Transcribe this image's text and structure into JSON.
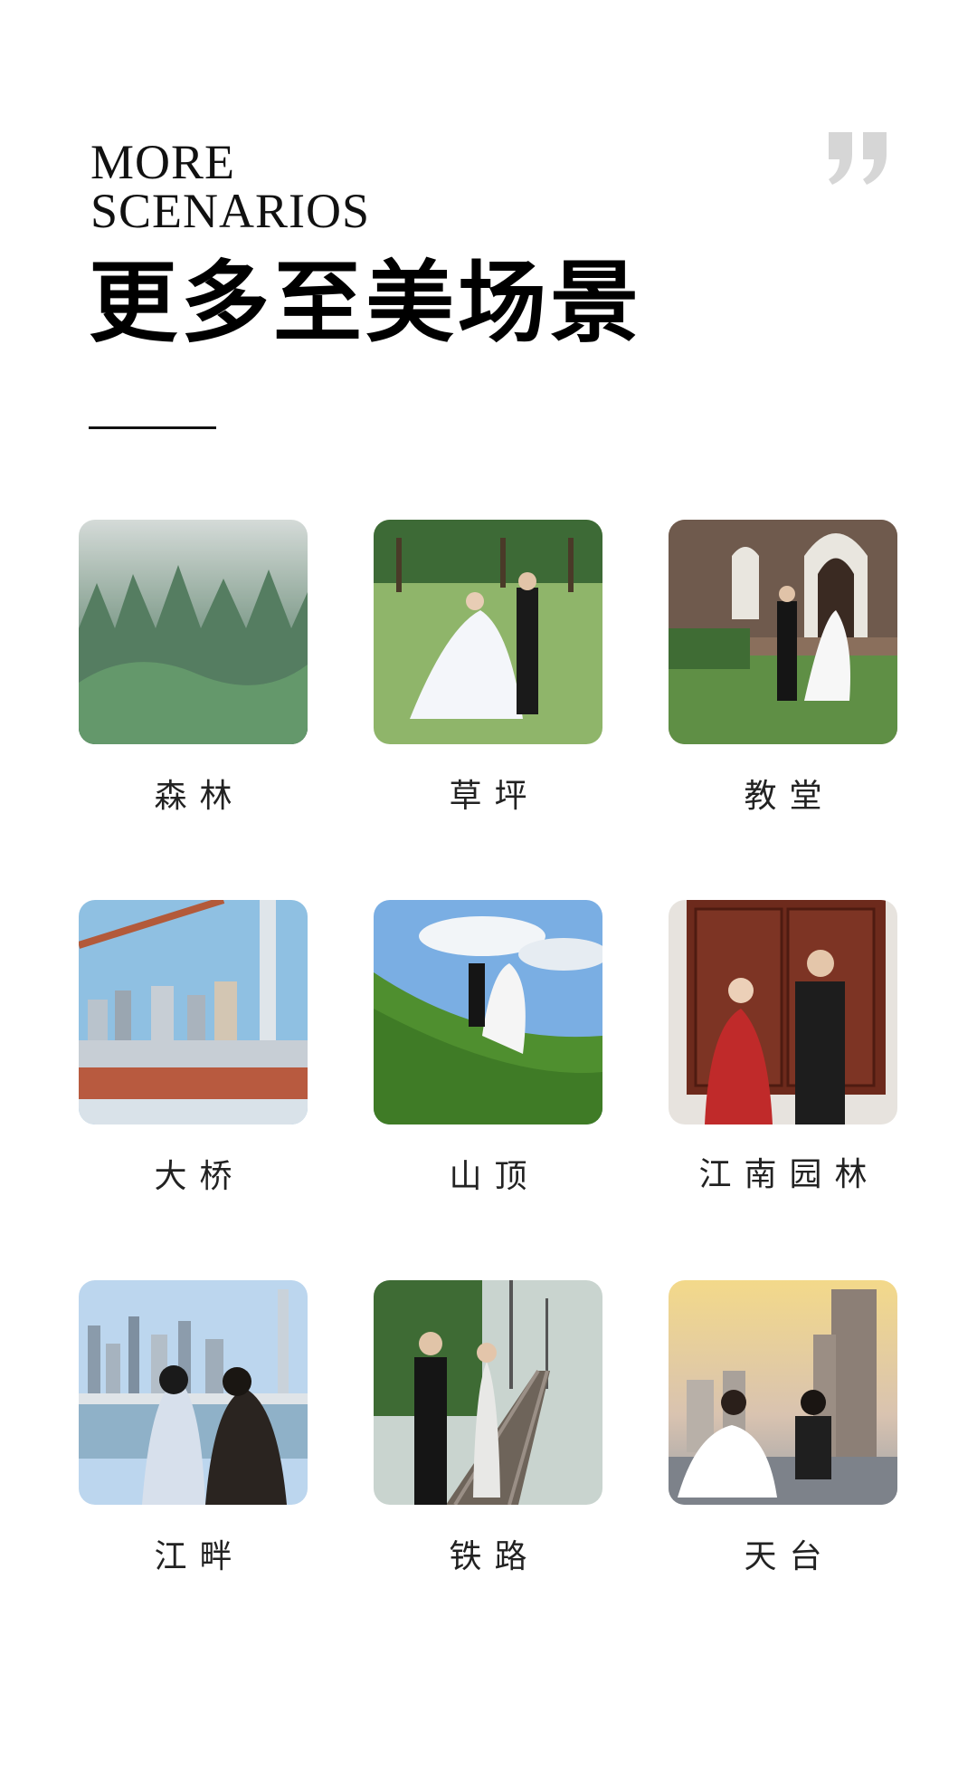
{
  "header": {
    "eyebrow_line1": "MORE",
    "eyebrow_line2": "SCENARIOS",
    "title": "更多至美场景"
  },
  "icons": {
    "quote": "closing-quote-icon"
  },
  "colors": {
    "text": "#111111",
    "quote": "#d6d6d6",
    "background": "#ffffff"
  },
  "scenes": [
    {
      "label": "森林"
    },
    {
      "label": "草坪"
    },
    {
      "label": "教堂"
    },
    {
      "label": "大桥"
    },
    {
      "label": "山顶"
    },
    {
      "label": "江南园林"
    },
    {
      "label": "江畔"
    },
    {
      "label": "铁路"
    },
    {
      "label": "天台"
    }
  ]
}
